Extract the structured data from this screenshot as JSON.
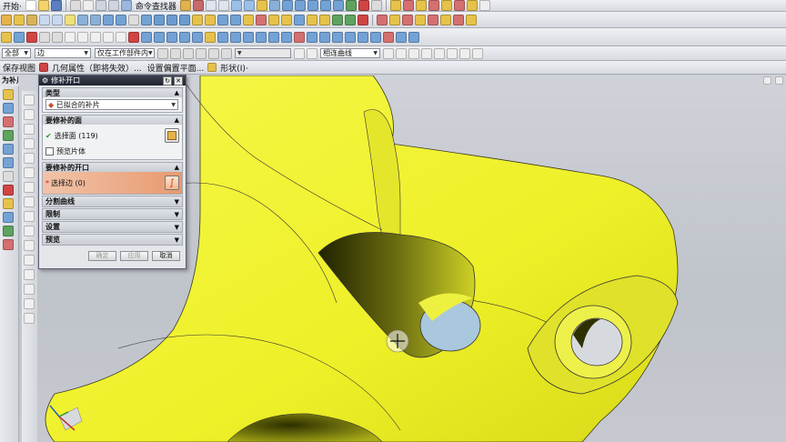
{
  "menu": {
    "start_label": "开始·",
    "command_finder": "命令查找器"
  },
  "filters": {
    "scope": "全部",
    "type": "边",
    "where": "仅在工作部件内",
    "curve_rule": "相连曲线"
  },
  "quickbar": {
    "save_view": "保存视图",
    "geom_attr": "几何属性（即将失效）...",
    "set_work_plane": "设置偏置平面...",
    "shape": "形状(I)·"
  },
  "panel_header": "为补片边界选",
  "dialog": {
    "title": "修补开口",
    "type_section": "类型",
    "type_value": "已拟合的补片",
    "face_section": "要修补的面",
    "select_face": "选择面 (119)",
    "preview_body": "预览片体",
    "opening_section": "要修补的开口",
    "select_edge": "选择边 (0)",
    "split_curve": "分割曲线",
    "limit": "限制",
    "settings": "设置",
    "preview": "预览",
    "ok": "确定",
    "apply": "应用",
    "cancel": "取消"
  },
  "colors": {
    "part": "#f2f531",
    "hole": "#a9c7dd",
    "title_bar": "#2b2f3c"
  }
}
